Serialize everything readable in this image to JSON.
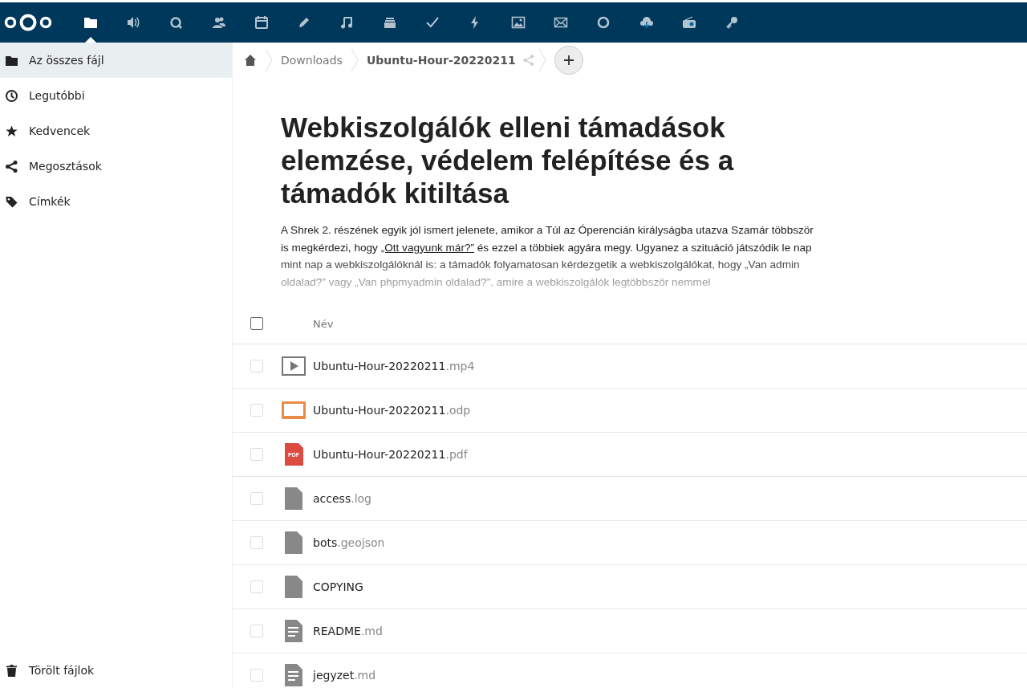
{
  "header": {
    "apps": [
      {
        "kind": "files",
        "selected": true
      },
      {
        "kind": "audio",
        "selected": false
      },
      {
        "kind": "talk",
        "selected": false
      },
      {
        "kind": "contacts",
        "selected": false
      },
      {
        "kind": "calendar",
        "selected": false
      },
      {
        "kind": "pencil",
        "selected": false
      },
      {
        "kind": "music",
        "selected": false
      },
      {
        "kind": "deck",
        "selected": false
      },
      {
        "kind": "tasks",
        "selected": false
      },
      {
        "kind": "activity",
        "selected": false
      },
      {
        "kind": "photos",
        "selected": false
      },
      {
        "kind": "mail",
        "selected": false
      },
      {
        "kind": "circle",
        "selected": false
      },
      {
        "kind": "cloud",
        "selected": false
      },
      {
        "kind": "radio",
        "selected": false
      },
      {
        "kind": "key",
        "selected": false
      }
    ]
  },
  "sidebar": {
    "items": [
      {
        "label": "Az összes fájl",
        "selected": true
      },
      {
        "label": "Legutóbbi",
        "selected": false
      },
      {
        "label": "Kedvencek",
        "selected": false
      },
      {
        "label": "Megosztások",
        "selected": false
      },
      {
        "label": "Címkék",
        "selected": false
      }
    ],
    "footer": {
      "label": "Törölt fájlok"
    }
  },
  "breadcrumbs": [
    {
      "label": "Downloads",
      "current": false
    },
    {
      "label": "Ubuntu-Hour-20220211",
      "current": true
    }
  ],
  "readme": {
    "title": "Webkiszolgálók elleni támadások elemzése, védelem felépítése és a támadók kitiltása",
    "text_before": "A Shrek 2. részének egyik jól ismert jelenete, amikor a Túl az Óperencián királyságba utazva Szamár többször is megkérdezi, hogy ",
    "link": "„Ott vagyunk már?”",
    "text_after": " és ezzel a többiek agyára megy. Ugyanez a szituáció játszódik le nap mint nap a webkiszolgálóknál is: a támadók folyamatosan kérdezgetik a webkiszolgálókat, hogy „Van admin oldalad?” vagy „Van phpmyadmin oldalad?”, amire a webkiszolgálók legtöbbször nemmel"
  },
  "table": {
    "column_name": "Név",
    "select_all_checked": false,
    "rows": [
      {
        "name": "Ubuntu-Hour-20220211",
        "ext": ".mp4",
        "kind": "video",
        "checked": false
      },
      {
        "name": "Ubuntu-Hour-20220211",
        "ext": ".odp",
        "kind": "presentation",
        "checked": false
      },
      {
        "name": "Ubuntu-Hour-20220211",
        "ext": ".pdf",
        "kind": "pdf",
        "badge": "PDF",
        "checked": false
      },
      {
        "name": "access",
        "ext": ".log",
        "kind": "file",
        "checked": false
      },
      {
        "name": "bots",
        "ext": ".geojson",
        "kind": "file",
        "checked": false
      },
      {
        "name": "COPYING",
        "kind": "file",
        "checked": false
      },
      {
        "name": "README",
        "ext": ".md",
        "kind": "text",
        "checked": false
      },
      {
        "name": "jegyzet",
        "ext": ".md",
        "kind": "text",
        "checked": false
      }
    ]
  }
}
